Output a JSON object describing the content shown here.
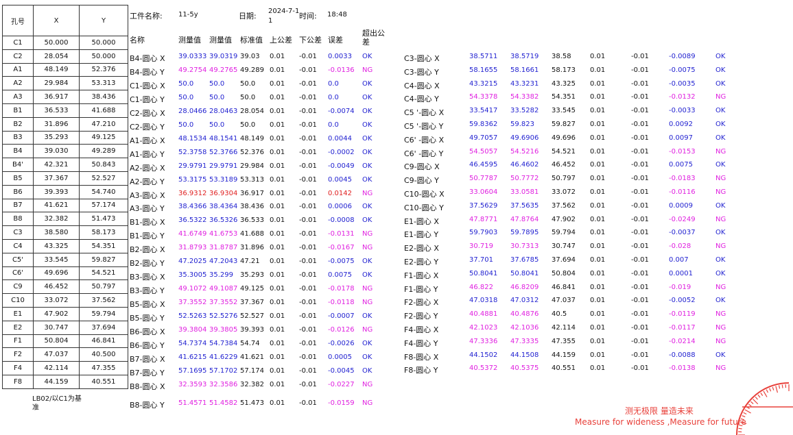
{
  "left_table": {
    "headers": [
      "孔号",
      "X",
      "Y"
    ],
    "rows": [
      [
        "C1",
        "50.000",
        "50.000"
      ],
      [
        "C2",
        "28.054",
        "50.000"
      ],
      [
        "A1",
        "48.149",
        "52.376"
      ],
      [
        "A2",
        "29.984",
        "53.313"
      ],
      [
        "A3",
        "36.917",
        "38.436"
      ],
      [
        "B1",
        "36.533",
        "41.688"
      ],
      [
        "B2",
        "31.896",
        "47.210"
      ],
      [
        "B3",
        "35.293",
        "49.125"
      ],
      [
        "B4",
        "39.030",
        "49.289"
      ],
      [
        "B4'",
        "42.321",
        "50.843"
      ],
      [
        "B5",
        "37.367",
        "52.527"
      ],
      [
        "B6",
        "39.393",
        "54.740"
      ],
      [
        "B7",
        "41.621",
        "57.174"
      ],
      [
        "B8",
        "32.382",
        "51.473"
      ],
      [
        "C3",
        "38.580",
        "58.173"
      ],
      [
        "C4",
        "43.325",
        "54.351"
      ],
      [
        "C5'",
        "33.545",
        "59.827"
      ],
      [
        "C6'",
        "49.696",
        "54.521"
      ],
      [
        "C9",
        "46.452",
        "50.797"
      ],
      [
        "C10",
        "33.072",
        "37.562"
      ],
      [
        "E1",
        "47.902",
        "59.794"
      ],
      [
        "E2",
        "30.747",
        "37.694"
      ],
      [
        "F1",
        "50.804",
        "46.841"
      ],
      [
        "F2",
        "47.037",
        "40.500"
      ],
      [
        "F4",
        "42.114",
        "47.355"
      ],
      [
        "F8",
        "44.159",
        "40.551"
      ]
    ],
    "note": "LB02/以C1为基准"
  },
  "info": {
    "workpiece_label": "工件名称:",
    "workpiece_value": "11-5y",
    "date_label": "日期:",
    "date_value": "2024-7-11",
    "time_label": "时间:",
    "time_value": "18:48"
  },
  "middle_headers": [
    "名称",
    "测量值",
    "测量值",
    "标准值",
    "上公差",
    "下公差",
    "误差",
    "超出公差"
  ],
  "middle_rows": [
    [
      "B4-圆心 X",
      "39.0333",
      "39.0319",
      "39.03",
      "0.01",
      "-0.01",
      "0.0033",
      "OK",
      "b"
    ],
    [
      "B4-圆心 Y",
      "49.2754",
      "49.2765",
      "49.289",
      "0.01",
      "-0.01",
      "-0.0136",
      "NG",
      "m"
    ],
    [
      "C1-圆心 X",
      "50.0",
      "50.0",
      "50.0",
      "0.01",
      "-0.01",
      "0.0",
      "OK",
      "b"
    ],
    [
      "C1-圆心 Y",
      "50.0",
      "50.0",
      "50.0",
      "0.01",
      "-0.01",
      "0.0",
      "OK",
      "b"
    ],
    [
      "C2-圆心 X",
      "28.0466",
      "28.0463",
      "28.054",
      "0.01",
      "-0.01",
      "-0.0074",
      "OK",
      "b"
    ],
    [
      "C2-圆心 Y",
      "50.0",
      "50.0",
      "50.0",
      "0.01",
      "-0.01",
      "0.0",
      "OK",
      "b"
    ],
    [
      "A1-圆心 X",
      "48.1534",
      "48.1541",
      "48.149",
      "0.01",
      "-0.01",
      "0.0044",
      "OK",
      "b"
    ],
    [
      "A1-圆心 Y",
      "52.3758",
      "52.3766",
      "52.376",
      "0.01",
      "-0.01",
      "-0.0002",
      "OK",
      "b"
    ],
    [
      "A2-圆心 X",
      "29.9791",
      "29.9791",
      "29.984",
      "0.01",
      "-0.01",
      "-0.0049",
      "OK",
      "b"
    ],
    [
      "A2-圆心 Y",
      "53.3175",
      "53.3189",
      "53.313",
      "0.01",
      "-0.01",
      "0.0045",
      "OK",
      "b"
    ],
    [
      "A3-圆心 X",
      "36.9312",
      "36.9304",
      "36.917",
      "0.01",
      "-0.01",
      "0.0142",
      "NG",
      "r"
    ],
    [
      "A3-圆心 Y",
      "38.4366",
      "38.4364",
      "38.436",
      "0.01",
      "-0.01",
      "0.0006",
      "OK",
      "b"
    ],
    [
      "B1-圆心 X",
      "36.5322",
      "36.5326",
      "36.533",
      "0.01",
      "-0.01",
      "-0.0008",
      "OK",
      "b"
    ],
    [
      "B1-圆心 Y",
      "41.6749",
      "41.6753",
      "41.688",
      "0.01",
      "-0.01",
      "-0.0131",
      "NG",
      "m"
    ],
    [
      "B2-圆心 X",
      "31.8793",
      "31.8787",
      "31.896",
      "0.01",
      "-0.01",
      "-0.0167",
      "NG",
      "m"
    ],
    [
      "B2-圆心 Y",
      "47.2025",
      "47.2043",
      "47.21",
      "0.01",
      "-0.01",
      "-0.0075",
      "OK",
      "b"
    ],
    [
      "B3-圆心 X",
      "35.3005",
      "35.299",
      "35.293",
      "0.01",
      "-0.01",
      "0.0075",
      "OK",
      "b"
    ],
    [
      "B3-圆心 Y",
      "49.1072",
      "49.1087",
      "49.125",
      "0.01",
      "-0.01",
      "-0.0178",
      "NG",
      "m"
    ],
    [
      "B5-圆心 X",
      "37.3552",
      "37.3552",
      "37.367",
      "0.01",
      "-0.01",
      "-0.0118",
      "NG",
      "m"
    ],
    [
      "B5-圆心 Y",
      "52.5263",
      "52.5276",
      "52.527",
      "0.01",
      "-0.01",
      "-0.0007",
      "OK",
      "b"
    ],
    [
      "B6-圆心 X",
      "39.3804",
      "39.3805",
      "39.393",
      "0.01",
      "-0.01",
      "-0.0126",
      "NG",
      "m"
    ],
    [
      "B6-圆心 Y",
      "54.7374",
      "54.7384",
      "54.74",
      "0.01",
      "-0.01",
      "-0.0026",
      "OK",
      "b"
    ],
    [
      "B7-圆心 X",
      "41.6215",
      "41.6229",
      "41.621",
      "0.01",
      "-0.01",
      "0.0005",
      "OK",
      "b"
    ],
    [
      "B7-圆心 Y",
      "57.1695",
      "57.1702",
      "57.174",
      "0.01",
      "-0.01",
      "-0.0045",
      "OK",
      "b"
    ],
    [
      "B8-圆心 X",
      "32.3593",
      "32.3586",
      "32.382",
      "0.01",
      "-0.01",
      "-0.0227",
      "NG",
      "m"
    ],
    [
      "B8-圆心 Y",
      "51.4571",
      "51.4582",
      "51.473",
      "0.01",
      "-0.01",
      "-0.0159",
      "NG",
      "m"
    ]
  ],
  "right_rows": [
    [
      "C3-圆心 X",
      "38.5711",
      "38.5719",
      "38.58",
      "0.01",
      "-0.01",
      "-0.0089",
      "OK",
      "b"
    ],
    [
      "C3-圆心 Y",
      "58.1655",
      "58.1661",
      "58.173",
      "0.01",
      "-0.01",
      "-0.0075",
      "OK",
      "b"
    ],
    [
      "C4-圆心 X",
      "43.3215",
      "43.3231",
      "43.325",
      "0.01",
      "-0.01",
      "-0.0035",
      "OK",
      "b"
    ],
    [
      "C4-圆心 Y",
      "54.3378",
      "54.3382",
      "54.351",
      "0.01",
      "-0.01",
      "-0.0132",
      "NG",
      "m"
    ],
    [
      "C5 '-圆心 X",
      "33.5417",
      "33.5282",
      "33.545",
      "0.01",
      "-0.01",
      "-0.0033",
      "OK",
      "b"
    ],
    [
      "C5 '-圆心 Y",
      "59.8362",
      "59.823",
      "59.827",
      "0.01",
      "-0.01",
      "0.0092",
      "OK",
      "b"
    ],
    [
      "C6' -圆心 X",
      "49.7057",
      "49.6906",
      "49.696",
      "0.01",
      "-0.01",
      "0.0097",
      "OK",
      "b"
    ],
    [
      "C6' -圆心 Y",
      "54.5057",
      "54.5216",
      "54.521",
      "0.01",
      "-0.01",
      "-0.0153",
      "NG",
      "m"
    ],
    [
      "C9-圆心 X",
      "46.4595",
      "46.4602",
      "46.452",
      "0.01",
      "-0.01",
      "0.0075",
      "OK",
      "b"
    ],
    [
      "C9-圆心 Y",
      "50.7787",
      "50.7772",
      "50.797",
      "0.01",
      "-0.01",
      "-0.0183",
      "NG",
      "m"
    ],
    [
      "C10-圆心 X",
      "33.0604",
      "33.0581",
      "33.072",
      "0.01",
      "-0.01",
      "-0.0116",
      "NG",
      "m"
    ],
    [
      "C10-圆心 Y",
      "37.5629",
      "37.5635",
      "37.562",
      "0.01",
      "-0.01",
      "0.0009",
      "OK",
      "b"
    ],
    [
      "E1-圆心 X",
      "47.8771",
      "47.8764",
      "47.902",
      "0.01",
      "-0.01",
      "-0.0249",
      "NG",
      "m"
    ],
    [
      "E1-圆心 Y",
      "59.7903",
      "59.7895",
      "59.794",
      "0.01",
      "-0.01",
      "-0.0037",
      "OK",
      "b"
    ],
    [
      "E2-圆心 X",
      "30.719",
      "30.7313",
      "30.747",
      "0.01",
      "-0.01",
      "-0.028",
      "NG",
      "m"
    ],
    [
      "E2-圆心 Y",
      "37.701",
      "37.6785",
      "37.694",
      "0.01",
      "-0.01",
      "0.007",
      "OK",
      "b"
    ],
    [
      "F1-圆心 X",
      "50.8041",
      "50.8041",
      "50.804",
      "0.01",
      "-0.01",
      "0.0001",
      "OK",
      "b"
    ],
    [
      "F1-圆心 Y",
      "46.822",
      "46.8209",
      "46.841",
      "0.01",
      "-0.01",
      "-0.019",
      "NG",
      "m"
    ],
    [
      "F2-圆心 X",
      "47.0318",
      "47.0312",
      "47.037",
      "0.01",
      "-0.01",
      "-0.0052",
      "OK",
      "b"
    ],
    [
      "F2-圆心 Y",
      "40.4881",
      "40.4876",
      "40.5",
      "0.01",
      "-0.01",
      "-0.0119",
      "NG",
      "m"
    ],
    [
      "F4-圆心 X",
      "42.1023",
      "42.1036",
      "42.114",
      "0.01",
      "-0.01",
      "-0.0117",
      "NG",
      "m"
    ],
    [
      "F4-圆心 Y",
      "47.3336",
      "47.3335",
      "47.355",
      "0.01",
      "-0.01",
      "-0.0214",
      "NG",
      "m"
    ],
    [
      "F8-圆心 X",
      "44.1502",
      "44.1508",
      "44.159",
      "0.01",
      "-0.01",
      "-0.0088",
      "OK",
      "b"
    ],
    [
      "F8-圆心 Y",
      "40.5372",
      "40.5375",
      "40.551",
      "0.01",
      "-0.01",
      "-0.0138",
      "NG",
      "m"
    ]
  ],
  "logo": {
    "slogan_cn": "测无极限  量造未来",
    "slogan_en": "Measure for wideness  ,Measure for future",
    "accent_color": "#e8403a"
  }
}
